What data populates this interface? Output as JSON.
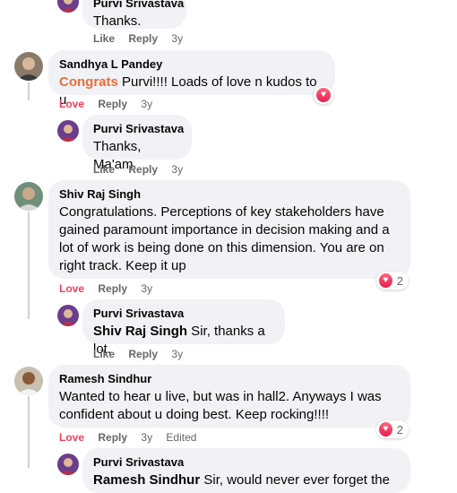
{
  "comments": [
    {
      "author": "Purvi Srivastava",
      "text": "Thanks.",
      "actions": {
        "like": "Like",
        "reply": "Reply",
        "time": "3y"
      }
    },
    {
      "author": "Sandhya L Pandey",
      "text_highlight": "Congrats",
      "text_rest": " Purvi!!!! Loads of love n kudos to u",
      "actions": {
        "like": "Love",
        "reply": "Reply",
        "time": "3y"
      }
    },
    {
      "author": "Purvi Srivastava",
      "text": "Thanks, Ma'am",
      "actions": {
        "like": "Like",
        "reply": "Reply",
        "time": "3y"
      }
    },
    {
      "author": "Shiv Raj Singh",
      "text": "Congratulations. Perceptions of key stakeholders have gained paramount importance in decision making and a lot of work is being done on this dimension. You are on right track. Keep it up",
      "reaction_count": "2",
      "actions": {
        "like": "Love",
        "reply": "Reply",
        "time": "3y"
      }
    },
    {
      "author": "Purvi Srivastava",
      "mention": "Shiv Raj Singh",
      "text": " Sir, thanks a lot.",
      "actions": {
        "like": "Like",
        "reply": "Reply",
        "time": "3y"
      }
    },
    {
      "author": "Ramesh Sindhur",
      "text": "Wanted to hear u live, but was in hall2. Anyways I was confident about u doing best. Keep rocking!!!!",
      "reaction_count": "2",
      "actions": {
        "like": "Love",
        "reply": "Reply",
        "time": "3y",
        "edited": "Edited"
      }
    },
    {
      "author": "Purvi Srivastava",
      "mention": "Ramesh Sindhur",
      "text": " Sir, would never ever forget the"
    }
  ],
  "icons": {
    "reaction": "heart-icon"
  },
  "colors": {
    "love": "#f33e58",
    "congrats": "#e8703a",
    "bubble": "#f0f2f5"
  }
}
